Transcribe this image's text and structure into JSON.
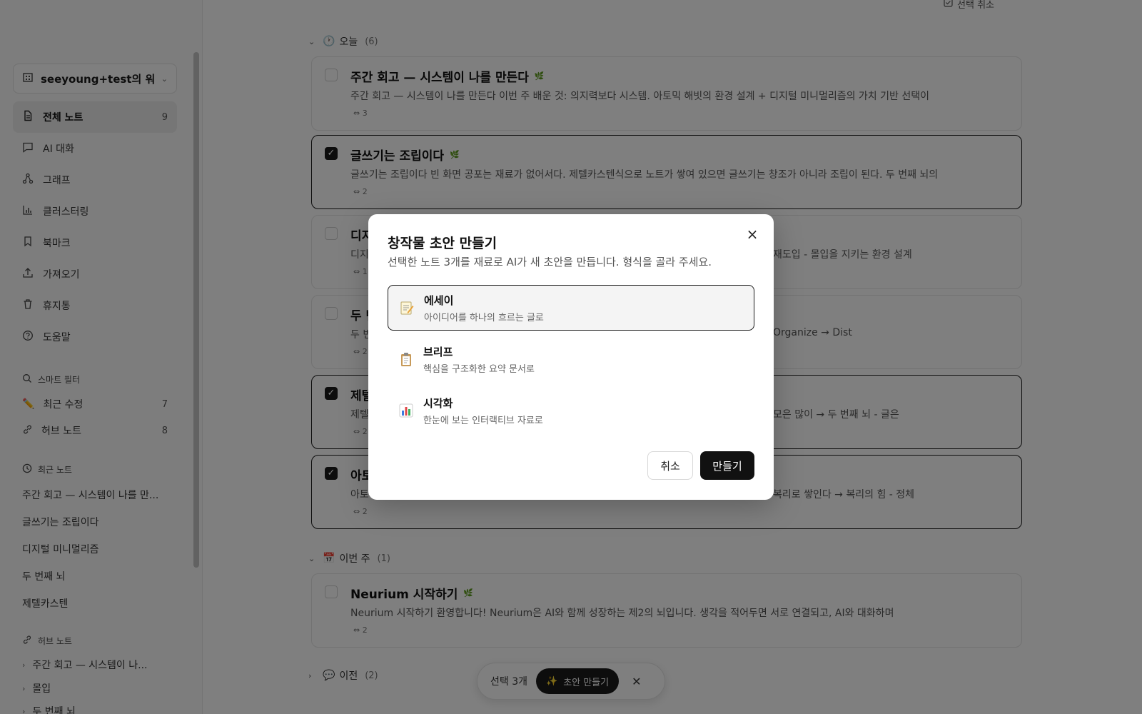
{
  "sidebar": {
    "workspace_name": "seeyoung+test의 워...",
    "nav": [
      {
        "label": "전체 노트",
        "count": "9",
        "icon": "document-icon"
      },
      {
        "label": "AI 대화",
        "count": "",
        "icon": "chat-icon"
      },
      {
        "label": "그래프",
        "count": "",
        "icon": "graph-icon"
      },
      {
        "label": "클러스터링",
        "count": "",
        "icon": "bar-chart-icon"
      },
      {
        "label": "북마크",
        "count": "",
        "icon": "bookmark-icon"
      },
      {
        "label": "가져오기",
        "count": "",
        "icon": "upload-icon"
      },
      {
        "label": "휴지통",
        "count": "",
        "icon": "trash-icon"
      },
      {
        "label": "도움말",
        "count": "",
        "icon": "help-icon"
      }
    ],
    "smart_filter_title": "스마트 필터",
    "filters": [
      {
        "label": "최근 수정",
        "count": "7"
      },
      {
        "label": "허브 노트",
        "count": "8"
      }
    ],
    "recent_title": "최근 노트",
    "recent": [
      "주간 회고 — 시스템이 나를 만...",
      "글쓰기는 조립이다",
      "디지털 미니멀리즘",
      "두 번째 뇌",
      "제텔카스텐"
    ],
    "hub_title": "허브 노트",
    "hubs": [
      "주간 회고 — 시스템이 나...",
      "몰입",
      "두 번째 뇌"
    ]
  },
  "main": {
    "top_action": "선택 취소",
    "groups": [
      {
        "title": "오늘",
        "count": "(6)"
      },
      {
        "title": "이번 주",
        "count": "(1)"
      },
      {
        "title": "이전",
        "count": "(2)"
      }
    ],
    "cards": [
      {
        "title": "주간 회고 — 시스템이 나를 만든다",
        "body": "주간 회고 — 시스템이 나를 만든다 이번 주 배운 것: 의지력보다 시스템. 아토믹 해빗의 환경 설계 + 디지털 미니멀리즘의 가치 기반 선택이",
        "links": "⇔ 3",
        "selected": false
      },
      {
        "title": "글쓰기는 조립이다",
        "body": "글쓰기는 조립이다 빈 화면 공포는 재료가 없어서다. 제텔카스텐식으로 노트가 쌓여 있으면 글쓰기는 창조가 아니라 조립이 된다. 두 번째 뇌의",
        "links": "⇔ 2",
        "selected": true
      },
      {
        "title": "디지",
        "body": "디지",
        "body_right": "재도입 - 몰입을 지키는 환경 설계",
        "links": "⇔ 1",
        "selected": false
      },
      {
        "title": "두 번",
        "body": "두 번",
        "body_right": "Organize → Dist",
        "links": "⇔ 2",
        "selected": false
      },
      {
        "title": "제텔",
        "body": "제텔",
        "body_right": "모은 많이 → 두 번째 뇌 - 글은",
        "links": "⇔ 2",
        "selected": true
      },
      {
        "title": "아토",
        "body": "아토",
        "body_right": "복리로 쌓인다 → 복리의 힘 - 정체",
        "links": "⇔ 2",
        "selected": true
      },
      {
        "title": "Neurium 시작하기",
        "body": "Neurium 시작하기 환영합니다! Neurium은 AI와 함께 성장하는 제2의 뇌입니다. 생각을 적어두면 서로 연결되고, AI와 대화하며",
        "links": "⇔ 2",
        "selected": false
      }
    ],
    "selection_bar": {
      "count_label": "선택 3개",
      "draft_label": "초안 만들기"
    }
  },
  "modal": {
    "title": "창작물 초안 만들기",
    "description": "선택한 노트 3개를 재료로 AI가 새 초안을 만듭니다. 형식을 골라 주세요.",
    "options": [
      {
        "name": "에세이",
        "desc": "아이디어를 하나의 흐르는 글로",
        "icon": "memo-icon",
        "selected": true
      },
      {
        "name": "브리프",
        "desc": "핵심을 구조화한 요약 문서로",
        "icon": "clipboard-icon",
        "selected": false
      },
      {
        "name": "시각화",
        "desc": "한눈에 보는 인터랙티브 자료로",
        "icon": "bar-chart-icon",
        "selected": false
      }
    ],
    "cancel_label": "취소",
    "create_label": "만들기"
  },
  "colors": {
    "accent": "#111111",
    "overlay": "rgba(0,0,0,0.5)",
    "leaf": "#3a8a3a"
  }
}
